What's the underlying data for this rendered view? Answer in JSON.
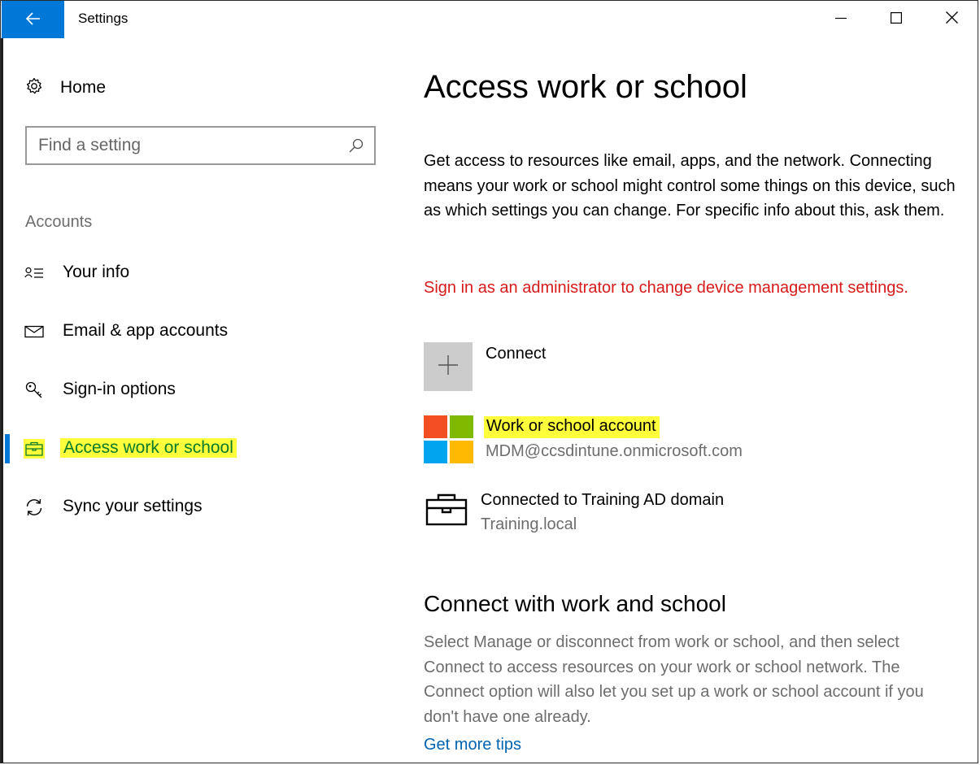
{
  "window": {
    "title": "Settings",
    "controls": {
      "minimize": "minimize-icon",
      "maximize": "maximize-icon",
      "close": "close-icon"
    }
  },
  "sidebar": {
    "home_label": "Home",
    "search_placeholder": "Find a setting",
    "section_label": "Accounts",
    "items": [
      {
        "label": "Your info",
        "icon": "contact-info-icon",
        "active": false
      },
      {
        "label": "Email & app accounts",
        "icon": "mail-icon",
        "active": false
      },
      {
        "label": "Sign-in options",
        "icon": "key-icon",
        "active": false
      },
      {
        "label": "Access work or school",
        "icon": "briefcase-icon",
        "active": true
      },
      {
        "label": "Sync your settings",
        "icon": "sync-icon",
        "active": false
      }
    ]
  },
  "main": {
    "title": "Access work or school",
    "description": "Get access to resources like email, apps, and the network. Connecting means your work or school might control some things on this device, such as which settings you can change. For specific info about this, ask them.",
    "warning": "Sign in as an administrator to change device management settings.",
    "connect_label": "Connect",
    "accounts": [
      {
        "title": "Work or school account",
        "subtitle": "MDM@ccsdintune.onmicrosoft.com",
        "icon": "microsoft-logo"
      },
      {
        "title": "Connected to Training AD domain",
        "subtitle": "Training.local",
        "icon": "briefcase-icon"
      }
    ],
    "section_heading": "Connect with work and school",
    "section_description": "Select Manage or disconnect from work or school, and then select Connect to access resources on your work or school network. The Connect option will also let you set up a work or school account if you don't have one already.",
    "tips_link": "Get more tips"
  },
  "colors": {
    "accent": "#0078d7",
    "highlight": "#ffff3b",
    "warning": "#d71a1a",
    "link": "#0063b1",
    "ms_red": "#f25022",
    "ms_green": "#7fba00",
    "ms_blue": "#00a4ef",
    "ms_yellow": "#ffb900"
  }
}
